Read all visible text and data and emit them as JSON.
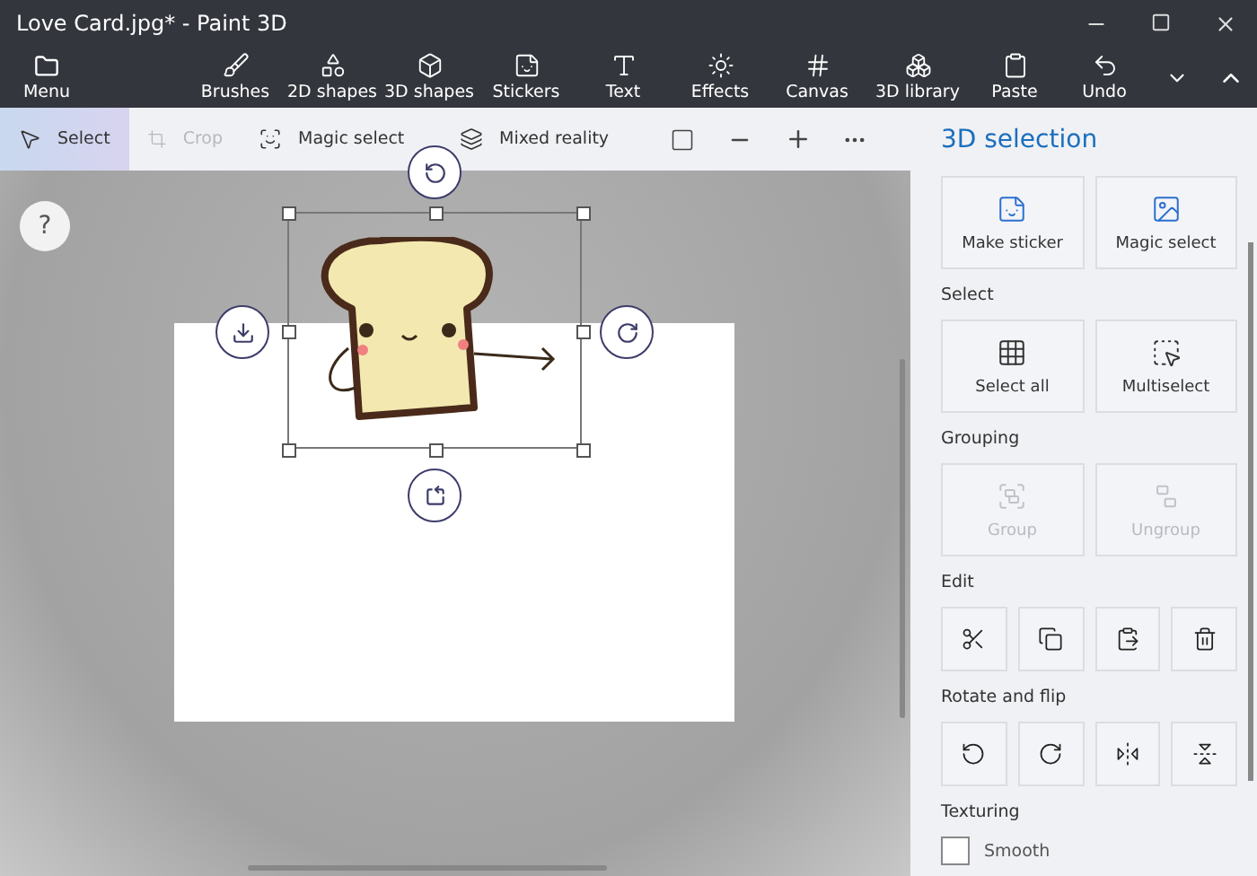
{
  "window": {
    "title": "Love Card.jpg* - Paint 3D"
  },
  "ribbon": {
    "menu": "Menu",
    "tools": [
      {
        "label": "Brushes"
      },
      {
        "label": "2D shapes"
      },
      {
        "label": "3D shapes"
      },
      {
        "label": "Stickers"
      },
      {
        "label": "Text"
      },
      {
        "label": "Effects"
      },
      {
        "label": "Canvas"
      },
      {
        "label": "3D library"
      }
    ],
    "actions": [
      {
        "label": "Paste"
      },
      {
        "label": "Undo"
      }
    ]
  },
  "toolbar": [
    {
      "label": "Select",
      "selected": true,
      "disabled": false
    },
    {
      "label": "Crop",
      "selected": false,
      "disabled": true
    },
    {
      "label": "Magic select",
      "selected": false,
      "disabled": false
    },
    {
      "label": "Mixed reality",
      "selected": false,
      "disabled": false
    }
  ],
  "canvas": {
    "help": "?"
  },
  "panel": {
    "title": "3D selection",
    "sections": [
      {
        "kind": "wide",
        "buttons": [
          {
            "label": "Make sticker",
            "disabled": false
          },
          {
            "label": "Magic select",
            "disabled": false
          }
        ]
      },
      {
        "kind": "wide",
        "heading": "Select",
        "buttons": [
          {
            "label": "Select all",
            "disabled": false
          },
          {
            "label": "Multiselect",
            "disabled": false
          }
        ]
      },
      {
        "kind": "wide",
        "heading": "Grouping",
        "buttons": [
          {
            "label": "Group",
            "disabled": true
          },
          {
            "label": "Ungroup",
            "disabled": true
          }
        ]
      },
      {
        "kind": "icons",
        "heading": "Edit",
        "buttons": [
          {
            "disabled": false
          },
          {
            "disabled": false
          },
          {
            "disabled": false
          },
          {
            "disabled": false
          }
        ]
      },
      {
        "kind": "icons",
        "heading": "Rotate and flip",
        "buttons": [
          {
            "disabled": false
          },
          {
            "disabled": false
          },
          {
            "disabled": false
          },
          {
            "disabled": false
          }
        ]
      },
      {
        "kind": "checkbox",
        "heading": "Texturing",
        "label": "Smooth",
        "checked": false
      }
    ]
  }
}
